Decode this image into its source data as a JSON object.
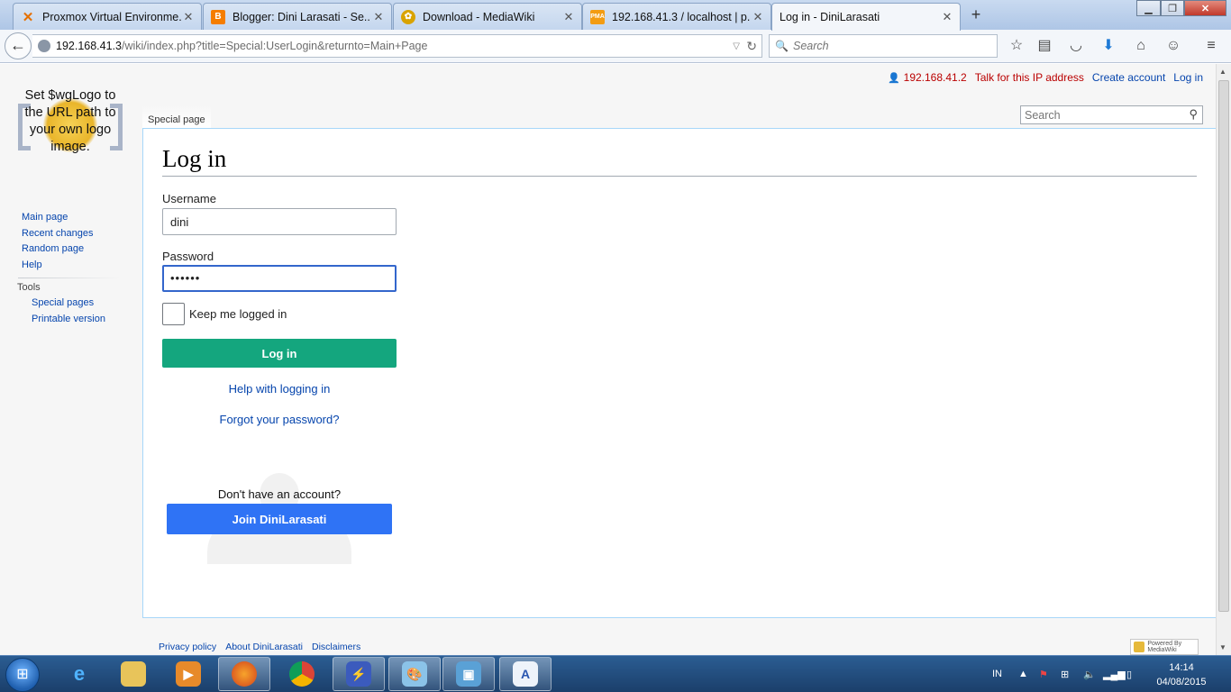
{
  "browser": {
    "tabs": [
      {
        "label": "Proxmox Virtual Environme...",
        "icon": "proxmox-icon",
        "icon_color": "#e57000"
      },
      {
        "label": "Blogger: Dini Larasati - Se...",
        "icon": "blogger-icon",
        "icon_color": "#f57d00"
      },
      {
        "label": "Download - MediaWiki",
        "icon": "mediawiki-icon",
        "icon_color": "#d9a300"
      },
      {
        "label": "192.168.41.3 / localhost | p...",
        "icon": "phpmyadmin-icon",
        "icon_color": "#f39c12"
      },
      {
        "label": "Log in - DiniLarasati",
        "icon": "none",
        "icon_color": ""
      }
    ],
    "active_tab": 4,
    "url_host": "192.168.41.3",
    "url_path": "/wiki/index.php?title=Special:UserLogin&returnto=Main+Page",
    "search_placeholder": "Search"
  },
  "wiki": {
    "logo_text": "Set $wgLogo to the URL path to your own logo image.",
    "personal": {
      "ip": "192.168.41.2",
      "talk": "Talk for this IP address",
      "create": "Create account",
      "login": "Log in"
    },
    "namespace_tab": "Special page",
    "search_placeholder": "Search",
    "nav": {
      "main": "Main page",
      "recent": "Recent changes",
      "random": "Random page",
      "help": "Help"
    },
    "tools": {
      "heading": "Tools",
      "special": "Special pages",
      "printable": "Printable version"
    },
    "form": {
      "heading": "Log in",
      "username_label": "Username",
      "username_value": "dini",
      "password_label": "Password",
      "password_value": "••••••",
      "remember_label": "Keep me logged in",
      "login_button": "Log in",
      "help_link": "Help with logging in",
      "forgot_link": "Forgot your password?",
      "no_account": "Don't have an account?",
      "join_button": "Join DiniLarasati"
    },
    "footer": {
      "privacy": "Privacy policy",
      "about": "About DiniLarasati",
      "disclaimers": "Disclaimers",
      "powered": "Powered By MediaWiki"
    },
    "colors": {
      "login_button": "#14a67e",
      "join_button": "#2f73f5",
      "link": "#0645ad",
      "ip_red": "#ba0000"
    }
  },
  "taskbar": {
    "lang": "IN",
    "time": "14:14",
    "date": "04/08/2015"
  }
}
